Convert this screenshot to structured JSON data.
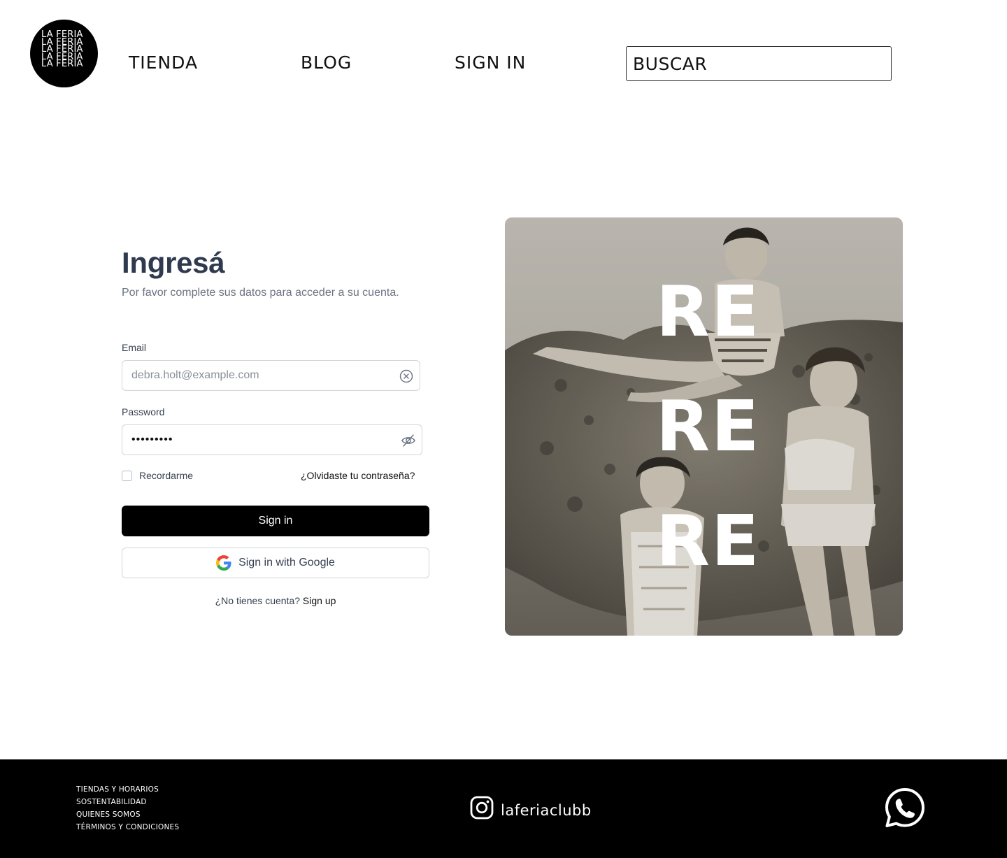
{
  "header": {
    "logo_lines": [
      "LA FERIA",
      "LA FERIA",
      "LA FERIA",
      "LA FERIA",
      "LA FERIA"
    ],
    "nav": {
      "tienda": "TIENDA",
      "blog": "BLOG",
      "signin": "SIGN IN"
    },
    "search": {
      "placeholder": "BUSCAR"
    }
  },
  "login": {
    "title": "Ingresá",
    "subtitle": "Por favor complete sus datos para acceder a su cuenta.",
    "email": {
      "label": "Email",
      "placeholder": "debra.holt@example.com",
      "icon": "clear-circle-icon"
    },
    "password": {
      "label": "Password",
      "value": "•••••••••",
      "icon": "eye-off-icon"
    },
    "remember_label": "Recordarme",
    "remember_checked": false,
    "forgot_label": "¿Olvidaste tu contraseña?",
    "signin_button": "Sign in",
    "google_button": "Sign in with Google",
    "no_account_text": "¿No tienes cuenta?",
    "signup_link": "Sign up"
  },
  "hero": {
    "words": [
      "RE",
      "RE",
      "RE"
    ],
    "image": "vintage sepia photo of three women in swimsuits on beach rocks"
  },
  "footer": {
    "links": [
      "TIENDAS Y HORARIOS",
      "SOSTENTABILIDAD",
      "QUIENES SOMOS",
      "TÉRMINOS Y CONDICIONES"
    ],
    "instagram_handle": "laferiaclubb",
    "instagram_icon": "instagram-icon",
    "whatsapp_icon": "whatsapp-icon"
  },
  "colors": {
    "title": "#2f3a4f",
    "primary_button": "#000000",
    "footer_bg": "#000000"
  }
}
